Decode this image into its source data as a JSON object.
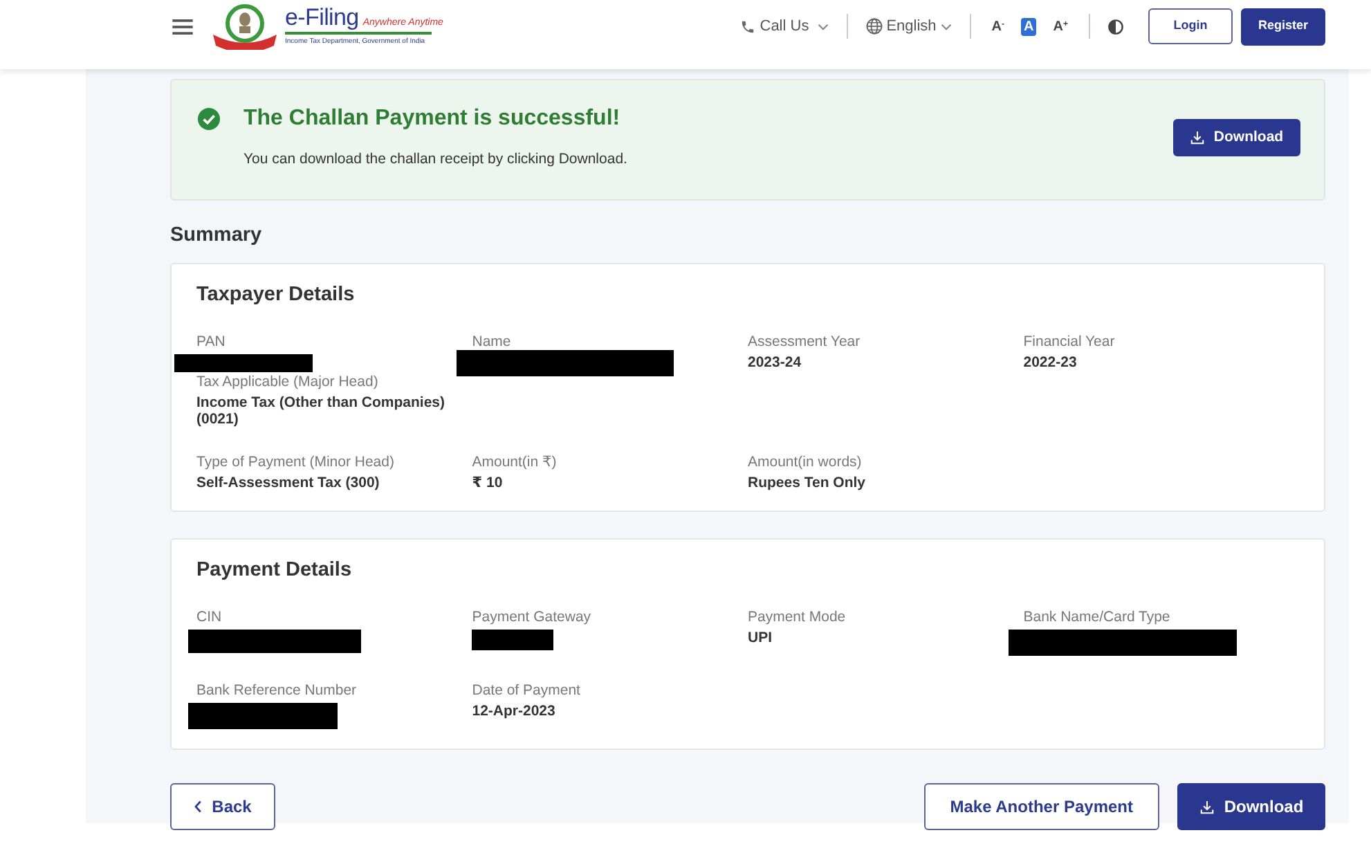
{
  "header": {
    "brand": {
      "title": "e-Filing",
      "tagline": "Anywhere Anytime",
      "subtitle": "Income Tax Department, Government of India"
    },
    "call_us": "Call Us",
    "language": "English",
    "font_sizes": [
      {
        "label": "A$^{-}$",
        "selected": false
      },
      {
        "label": "A",
        "selected": true
      },
      {
        "label": "A$^{+}$",
        "selected": false
      }
    ],
    "buttons": [
      {
        "label": "Login",
        "kind": "outline"
      },
      {
        "label": "Register",
        "kind": "primary"
      }
    ]
  },
  "alert": {
    "title": "The Challan Payment is successful!",
    "message": "You can download the challan receipt by clicking Download.",
    "button": "Download"
  },
  "summary": {
    "title": "Summary",
    "sections": [
      {
        "title": "Taxpayer Details",
        "rows": [
          [
            [
              {
                "label": "PAN",
                "redacted": true
              },
              {
                "label": "Tax Applicable (Major Head)",
                "value": "Income Tax (Other than Companies) (0021)",
                "redacted": false
              }
            ],
            [
              {
                "label": "Name",
                "redacted": true
              }
            ],
            [
              {
                "label": "Assessment Year",
                "value": "2023-24",
                "redacted": false
              }
            ],
            [
              {
                "label": "Financial Year",
                "value": "2022-23",
                "redacted": false
              }
            ]
          ],
          [
            [
              {
                "label": "Type of Payment (Minor Head)",
                "value": "Self-Assessment Tax (300)",
                "redacted": false
              }
            ],
            [
              {
                "label": "Amount(in ₹)",
                "value": "₹ 10",
                "redacted": false
              }
            ],
            [
              {
                "label": "Amount(in words)",
                "value": "Rupees Ten Only",
                "redacted": false
              }
            ]
          ]
        ]
      },
      {
        "title": "Payment Details",
        "rows": [
          [
            [
              {
                "label": "CIN",
                "redacted": true
              }
            ],
            [
              {
                "label": "Payment Gateway",
                "redacted": true
              }
            ],
            [
              {
                "label": "Payment Mode",
                "value": "UPI",
                "redacted": false
              }
            ],
            [
              {
                "label": "Bank Name/Card Type",
                "redacted": true
              }
            ]
          ],
          [
            [
              {
                "label": "Bank Reference Number",
                "redacted": true
              }
            ],
            [
              {
                "label": "Date of Payment",
                "value": "12-Apr-2023",
                "redacted": false
              }
            ]
          ]
        ]
      }
    ]
  },
  "actions": [
    {
      "label": "Back",
      "kind": "back"
    },
    {
      "label": "Make Another Payment",
      "kind": "outline"
    },
    {
      "label": "Download",
      "kind": "download"
    }
  ]
}
